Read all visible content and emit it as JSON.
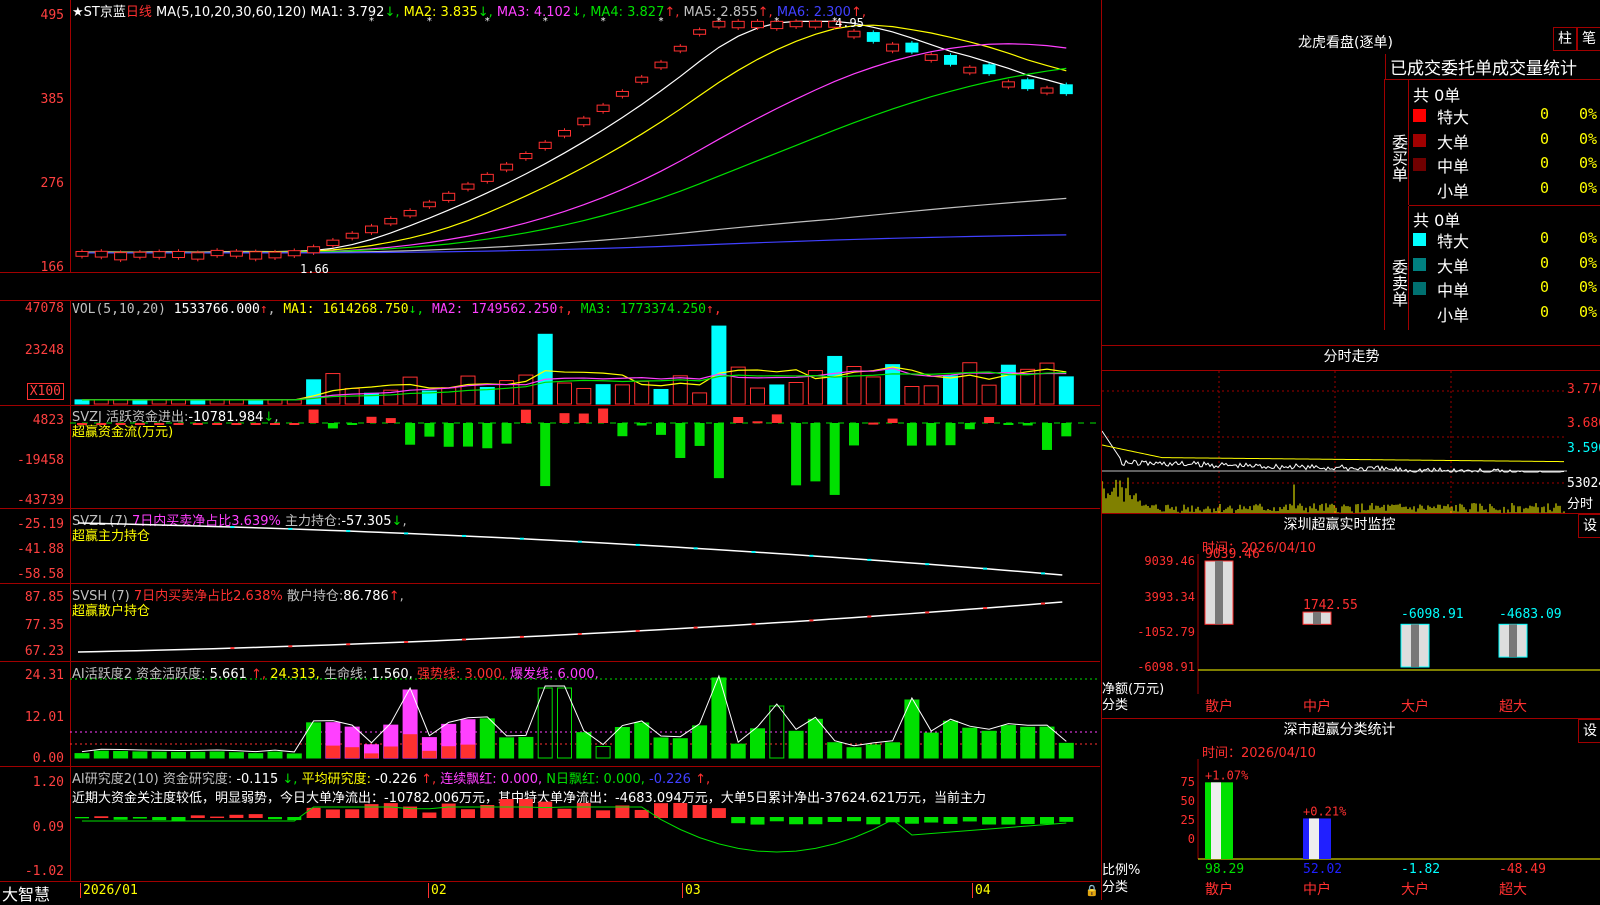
{
  "main": {
    "name": "★ST京蓝",
    "period": "日线",
    "ma_params": "MA(5,10,20,30,60,120)",
    "ma": [
      {
        "label": "MA1:",
        "value": "3.792",
        "arrow": "↓",
        "color": "#ffffff"
      },
      {
        "label": "MA2:",
        "value": "3.835",
        "arrow": "↓",
        "color": "#ffff00"
      },
      {
        "label": "MA3:",
        "value": "4.102",
        "arrow": "↓",
        "color": "#ff40ff"
      },
      {
        "label": "MA4:",
        "value": "3.827",
        "arrow": "↑",
        "color": "#00e000"
      },
      {
        "label": "MA5:",
        "value": "2.855",
        "arrow": "↑",
        "color": "#c0c0c0"
      },
      {
        "label": "MA6:",
        "value": "2.300",
        "arrow": "↑",
        "color": "#4040ff"
      }
    ],
    "y_labels": [
      "495",
      "385",
      "276",
      "166"
    ],
    "high_label": "4.95",
    "low_label": "1.66"
  },
  "vol": {
    "legend": "VOL(5,10,20)",
    "value": "1533766.000",
    "items": [
      {
        "label": "MA1:",
        "value": "1614268.750",
        "arrow": "↓",
        "color": "#ffff00"
      },
      {
        "label": "MA2:",
        "value": "1749562.250",
        "arrow": "↑",
        "color": "#ff40ff"
      },
      {
        "label": "MA3:",
        "value": "1773374.250",
        "arrow": "↑",
        "color": "#00e000"
      }
    ],
    "y_labels": [
      "47078",
      "23248"
    ],
    "unit": "X100"
  },
  "svzj": {
    "legend": "SVZJ",
    "item": "活跃资金进出:",
    "value": "-10781.984",
    "arrow": "↓",
    "sub": "超赢资金流(万元)",
    "y_labels": [
      "4823",
      "-19458",
      "-43739"
    ]
  },
  "svzl": {
    "legend": "SVZL (7)",
    "item1": "7日内买卖净占比3.639%",
    "item2": "主力持仓:",
    "value": "-57.305",
    "arrow": "↓",
    "sub": "超赢主力持仓",
    "y_labels": [
      "-25.19",
      "-41.88",
      "-58.58"
    ]
  },
  "svsh": {
    "legend": "SVSH (7)",
    "item1": "7日内买卖净占比2.638%",
    "item2": "散户持仓:",
    "value": "86.786",
    "arrow": "↑",
    "sub": "超赢散户持仓",
    "y_labels": [
      "87.85",
      "77.35",
      "67.23"
    ]
  },
  "ai_active": {
    "legend": "AI活跃度2",
    "items": [
      {
        "text": "资金活跃度:",
        "color": "#c0c0c0"
      },
      {
        "text": "5.661",
        "color": "#ffffff"
      },
      {
        "text": "↑,",
        "color": "#ff3030"
      },
      {
        "text": "24.313,",
        "color": "#ffff00"
      },
      {
        "text": "生命线:",
        "color": "#c0c0c0"
      },
      {
        "text": "1.560,",
        "color": "#ffffff"
      },
      {
        "text": "强势线:",
        "color": "#ff3030"
      },
      {
        "text": "3.000,",
        "color": "#ff3030"
      },
      {
        "text": "爆发线:",
        "color": "#ff40ff"
      },
      {
        "text": "6.000,",
        "color": "#ff40ff"
      }
    ],
    "y_labels": [
      "24.31",
      "12.01",
      "0.00"
    ]
  },
  "ai_research": {
    "legend": "AI研究度2(10)",
    "items": [
      {
        "text": "资金研究度:",
        "color": "#c0c0c0"
      },
      {
        "text": "-0.115",
        "color": "#ffffff"
      },
      {
        "text": "↓,",
        "color": "#00e000"
      },
      {
        "text": "平均研究度:",
        "color": "#ffff00"
      },
      {
        "text": "-0.226",
        "color": "#ffffff"
      },
      {
        "text": "↑,",
        "color": "#ff3030"
      },
      {
        "text": "连续飘红:",
        "color": "#ff40ff"
      },
      {
        "text": "0.000,",
        "color": "#ff40ff"
      },
      {
        "text": "N日飘红:",
        "color": "#00e000"
      },
      {
        "text": "0.000,",
        "color": "#00e000"
      },
      {
        "text": "-0.226",
        "color": "#4040ff"
      },
      {
        "text": "↑,",
        "color": "#ff3030"
      }
    ],
    "comment": "近期大资金关注度较低，明显弱势，今日大单净流出：-10782.006万元，其中特大单净流出：-4683.094万元，大单5日累计净出-37624.621万元，当前主力",
    "y_labels": [
      "1.20",
      "0.09",
      "-1.02"
    ]
  },
  "xaxis": {
    "labels": [
      "2026/01",
      "02",
      "03",
      "04"
    ],
    "brand": "大智慧"
  },
  "right": {
    "lhb_title": "龙虎看盘(逐单)",
    "btn_zhu": "柱",
    "btn_bi": "笔",
    "header": "已成交委托单成交量统计",
    "buy_label": "委买单",
    "sell_label": "委卖单",
    "buy_total": "共 0单",
    "sell_total": "共 0单",
    "buy_rows": [
      {
        "name": "特大",
        "count": "0",
        "pct": "0%",
        "color": "#ff0000"
      },
      {
        "name": "大单",
        "count": "0",
        "pct": "0%",
        "color": "#a00000"
      },
      {
        "name": "中单",
        "count": "0",
        "pct": "0%",
        "color": "#700000"
      },
      {
        "name": "小单",
        "count": "0",
        "pct": "0%",
        "color": "#000000"
      }
    ],
    "sell_rows": [
      {
        "name": "特大",
        "count": "0",
        "pct": "0%",
        "color": "#00ffff"
      },
      {
        "name": "大单",
        "count": "0",
        "pct": "0%",
        "color": "#008080"
      },
      {
        "name": "中单",
        "count": "0",
        "pct": "0%",
        "color": "#007070"
      },
      {
        "name": "小单",
        "count": "0",
        "pct": "0%",
        "color": "#000000"
      }
    ],
    "fenshi_title": "分时走势",
    "fenshi_prices": [
      "3.770",
      "3.680",
      "3.590"
    ],
    "fenshi_vol": "53024",
    "fenshi_label": "分时",
    "monitor_title": "深圳超赢实时监控",
    "monitor_btn": "设",
    "monitor_time": "时间：2026/04/10",
    "monitor_y": [
      "9039.46",
      "3993.34",
      "-1052.79",
      "-6098.91"
    ],
    "monitor_unit": "净额(万元)",
    "monitor_cat_lbl": "分类",
    "monitor_bars": [
      {
        "cat": "散户",
        "value": 9039.46,
        "label": "9039.46",
        "color": "#ff3030"
      },
      {
        "cat": "中户",
        "value": 1742.55,
        "label": "1742.55",
        "color": "#ff3030"
      },
      {
        "cat": "大户",
        "value": -6098.91,
        "label": "-6098.91",
        "color": "#00ffff"
      },
      {
        "cat": "超大",
        "value": -4683.09,
        "label": "-4683.09",
        "color": "#00ffff"
      }
    ],
    "class_title": "深市超赢分类统计",
    "class_btn": "设",
    "class_time": "时间：2026/04/10",
    "class_y": [
      "75",
      "50",
      "25",
      "0"
    ],
    "class_unit": "比例%",
    "class_cat_lbl": "分类",
    "class_bars": [
      {
        "cat": "散户",
        "value": 98.29,
        "label": "98.29",
        "top": "+1.07%",
        "color": "#00e000"
      },
      {
        "cat": "中户",
        "value": 52.02,
        "label": "52.02",
        "top": "+0.21%",
        "color": "#2020ff"
      },
      {
        "cat": "大户",
        "value": -1.82,
        "label": "-1.82",
        "top": "",
        "color": "#00ffff"
      },
      {
        "cat": "超大",
        "value": -48.49,
        "label": "-48.49",
        "top": "",
        "color": "#ff3030"
      }
    ]
  }
}
